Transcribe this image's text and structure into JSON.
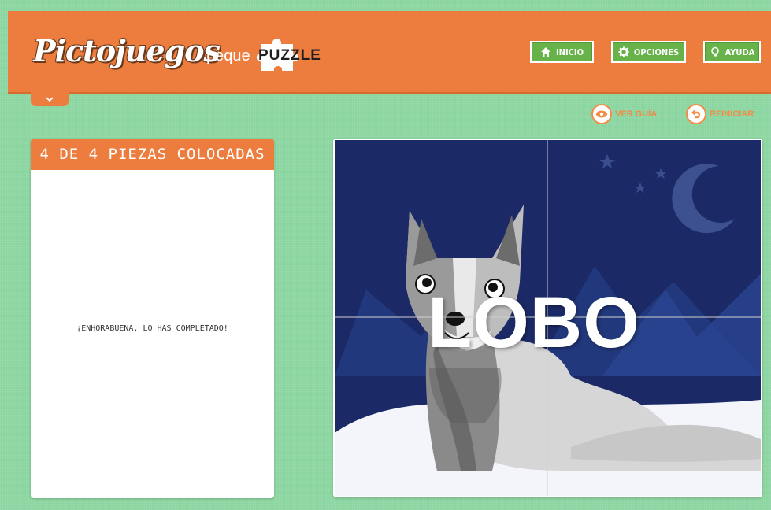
{
  "header": {
    "logo_text": "Pictojuegos",
    "sub_brand_prefix": "peque",
    "sub_brand_word": "PUZZLE",
    "nav": [
      {
        "label": "INICIO",
        "icon": "home-icon"
      },
      {
        "label": "OPCIONES",
        "icon": "gear-icon"
      },
      {
        "label": "AYUDA",
        "icon": "lightbulb-icon"
      }
    ]
  },
  "toolbar": {
    "guide_label": "VER GUÍA",
    "reset_label": "REINICIAR"
  },
  "status": {
    "pieces_placed": "4 DE 4 PIEZAS COLOCADAS",
    "message": "¡ENHORABUENA, LO HAS COMPLETADO!"
  },
  "puzzle": {
    "word": "LOBO",
    "pieces_total": 4,
    "pieces_placed": 4
  },
  "colors": {
    "orange": "#ec7d3f",
    "green_button": "#67b34a",
    "background": "#8bd6a0",
    "night_sky": "#1b2a66"
  }
}
